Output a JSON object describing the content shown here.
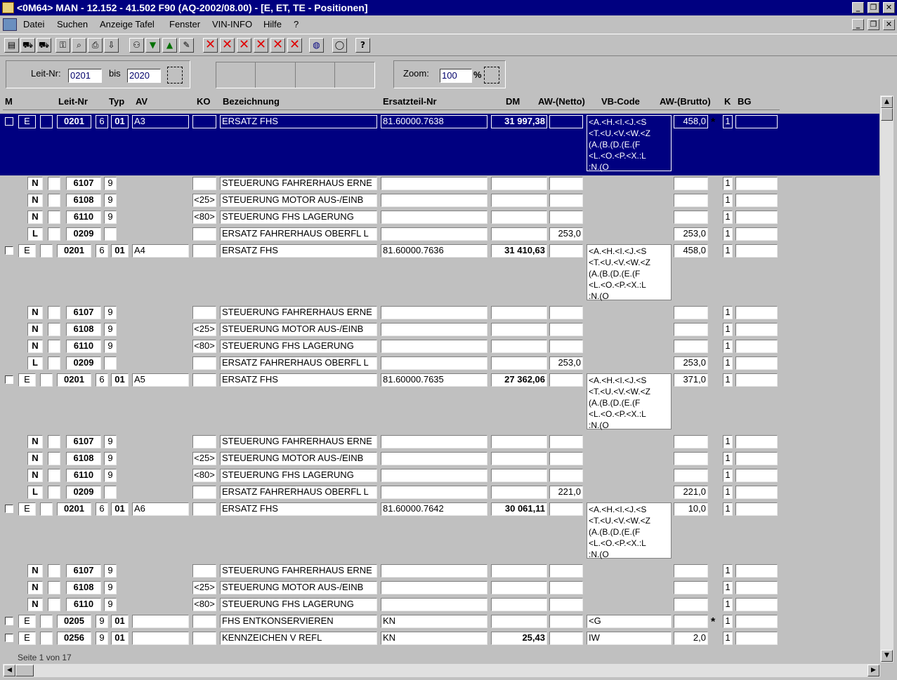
{
  "window": {
    "title": "<0M64> MAN  - 12.152 - 41.502 F90  (AQ-2002/08.00) - [E, ET, TE - Positionen]",
    "btn_min": "_",
    "btn_restore": "❐",
    "btn_close": "✕"
  },
  "menu": [
    "Datei",
    "Suchen",
    "Anzeige Tafel",
    "Fenster",
    "VIN-INFO",
    "Hilfe",
    "?"
  ],
  "toolbar_icons": [
    "cabinet-icon",
    "car-icon",
    "truck-icon",
    "key-icon",
    "magnifier-icon",
    "print-icon",
    "export-icon",
    "group-icon",
    "arrow-down-icon",
    "arrow-up-icon",
    "pen-icon",
    "delete-icon",
    "delete-icon",
    "delete-icon",
    "delete-icon",
    "delete-icon",
    "delete-icon",
    "globe-icon",
    "speech-bubble-icon",
    "help-icon"
  ],
  "filter": {
    "leit_label": "Leit-Nr:",
    "leit_from": "0201",
    "bis_label": "bis",
    "leit_to": "2020",
    "zoom_label": "Zoom:",
    "zoom_value": "100",
    "zoom_unit": "%"
  },
  "headers": [
    "M",
    "Leit-Nr",
    "Typ",
    "AV",
    "KO",
    "Bezeichnung",
    "Ersatzteil-Nr",
    "DM",
    "AW-(Netto)",
    "VB-Code",
    "AW-(Brutto)",
    "K",
    "BG"
  ],
  "status": "Seite 1 von 17",
  "groups": [
    {
      "selected": true,
      "main": {
        "m": "E",
        "leit": "0201",
        "typ": "6",
        "sub": "01",
        "av": "A3",
        "ko": "",
        "bez": "ERSATZ FHS",
        "teil": "81.60000.7638",
        "dm": "31 997,38",
        "netto": "",
        "vb": [
          "<A.<H.<I.<J.<S",
          "<T.<U.<V.<W.<Z",
          "(A.(B.(D.(E.(F",
          "<L.<O.<P.<X.:L",
          ":N.(O"
        ],
        "brutto": "458,0",
        "star": "*",
        "k": "1",
        "bg": ""
      },
      "subs": [
        {
          "m": "N",
          "leit": "6107",
          "typ": "9",
          "ko": "",
          "bez": "STEUERUNG FAHRERHAUS ERNE",
          "netto": "",
          "brutto": "",
          "k": "1"
        },
        {
          "m": "N",
          "leit": "6108",
          "typ": "9",
          "ko": "<25>",
          "bez": "STEUERUNG MOTOR AUS-/EINB",
          "netto": "",
          "brutto": "",
          "k": "1"
        },
        {
          "m": "N",
          "leit": "6110",
          "typ": "9",
          "ko": "<80>",
          "bez": "STEUERUNG FHS LAGERUNG",
          "netto": "",
          "brutto": "",
          "k": "1"
        },
        {
          "m": "L",
          "leit": "0209",
          "typ": "",
          "ko": "",
          "bez": "ERSATZ FAHRERHAUS OBERFL L",
          "netto": "253,0",
          "brutto": "253,0",
          "k": "1"
        }
      ]
    },
    {
      "selected": false,
      "main": {
        "m": "E",
        "leit": "0201",
        "typ": "6",
        "sub": "01",
        "av": "A4",
        "ko": "",
        "bez": "ERSATZ FHS",
        "teil": "81.60000.7636",
        "dm": "31 410,63",
        "netto": "",
        "vb": [
          "<A.<H.<I.<J.<S",
          "<T.<U.<V.<W.<Z",
          "(A.(B.(D.(E.(F",
          "<L.<O.<P.<X.:L",
          ":N.(O"
        ],
        "brutto": "458,0",
        "star": "",
        "k": "1",
        "bg": ""
      },
      "subs": [
        {
          "m": "N",
          "leit": "6107",
          "typ": "9",
          "ko": "",
          "bez": "STEUERUNG FAHRERHAUS ERNE",
          "netto": "",
          "brutto": "",
          "k": "1"
        },
        {
          "m": "N",
          "leit": "6108",
          "typ": "9",
          "ko": "<25>",
          "bez": "STEUERUNG MOTOR AUS-/EINB",
          "netto": "",
          "brutto": "",
          "k": "1"
        },
        {
          "m": "N",
          "leit": "6110",
          "typ": "9",
          "ko": "<80>",
          "bez": "STEUERUNG FHS LAGERUNG",
          "netto": "",
          "brutto": "",
          "k": "1"
        },
        {
          "m": "L",
          "leit": "0209",
          "typ": "",
          "ko": "",
          "bez": "ERSATZ FAHRERHAUS OBERFL L",
          "netto": "253,0",
          "brutto": "253,0",
          "k": "1"
        }
      ]
    },
    {
      "selected": false,
      "main": {
        "m": "E",
        "leit": "0201",
        "typ": "6",
        "sub": "01",
        "av": "A5",
        "ko": "",
        "bez": "ERSATZ FHS",
        "teil": "81.60000.7635",
        "dm": "27 362,06",
        "netto": "",
        "vb": [
          "<A.<H.<I.<J.<S",
          "<T.<U.<V.<W.<Z",
          "(A.(B.(D.(E.(F",
          "<L.<O.<P.<X.:L",
          ":N.(O"
        ],
        "brutto": "371,0",
        "star": "",
        "k": "1",
        "bg": ""
      },
      "subs": [
        {
          "m": "N",
          "leit": "6107",
          "typ": "9",
          "ko": "",
          "bez": "STEUERUNG FAHRERHAUS ERNE",
          "netto": "",
          "brutto": "",
          "k": "1"
        },
        {
          "m": "N",
          "leit": "6108",
          "typ": "9",
          "ko": "<25>",
          "bez": "STEUERUNG MOTOR AUS-/EINB",
          "netto": "",
          "brutto": "",
          "k": "1"
        },
        {
          "m": "N",
          "leit": "6110",
          "typ": "9",
          "ko": "<80>",
          "bez": "STEUERUNG FHS LAGERUNG",
          "netto": "",
          "brutto": "",
          "k": "1"
        },
        {
          "m": "L",
          "leit": "0209",
          "typ": "",
          "ko": "",
          "bez": "ERSATZ FAHRERHAUS OBERFL L",
          "netto": "221,0",
          "brutto": "221,0",
          "k": "1"
        }
      ]
    },
    {
      "selected": false,
      "main": {
        "m": "E",
        "leit": "0201",
        "typ": "6",
        "sub": "01",
        "av": "A6",
        "ko": "",
        "bez": "ERSATZ FHS",
        "teil": "81.60000.7642",
        "dm": "30 061,11",
        "netto": "",
        "vb": [
          "<A.<H.<I.<J.<S",
          "<T.<U.<V.<W.<Z",
          "(A.(B.(D.(E.(F",
          "<L.<O.<P.<X.:L",
          ":N.(O"
        ],
        "brutto": "10,0",
        "star": "",
        "k": "1",
        "bg": ""
      },
      "subs": [
        {
          "m": "N",
          "leit": "6107",
          "typ": "9",
          "ko": "",
          "bez": "STEUERUNG FAHRERHAUS ERNE",
          "netto": "",
          "brutto": "",
          "k": "1"
        },
        {
          "m": "N",
          "leit": "6108",
          "typ": "9",
          "ko": "<25>",
          "bez": "STEUERUNG MOTOR AUS-/EINB",
          "netto": "",
          "brutto": "",
          "k": "1"
        },
        {
          "m": "N",
          "leit": "6110",
          "typ": "9",
          "ko": "<80>",
          "bez": "STEUERUNG FHS LAGERUNG",
          "netto": "",
          "brutto": "",
          "k": "1"
        }
      ]
    },
    {
      "selected": false,
      "single": true,
      "main": {
        "m": "E",
        "leit": "0205",
        "typ": "9",
        "sub": "01",
        "av": "",
        "ko": "",
        "bez": "FHS ENTKONSERVIEREN",
        "teil": "KN",
        "dm": "",
        "netto": "",
        "vb1": "<G",
        "brutto": "",
        "star": "*",
        "k": "1",
        "bg": ""
      },
      "subs": []
    },
    {
      "selected": false,
      "single": true,
      "main": {
        "m": "E",
        "leit": "0256",
        "typ": "9",
        "sub": "01",
        "av": "",
        "ko": "",
        "bez": "KENNZEICHEN V REFL",
        "teil": "KN",
        "dm": "25,43",
        "netto": "",
        "vb1": "IW",
        "brutto": "2,0",
        "star": "",
        "k": "1",
        "bg": ""
      },
      "subs": []
    }
  ]
}
